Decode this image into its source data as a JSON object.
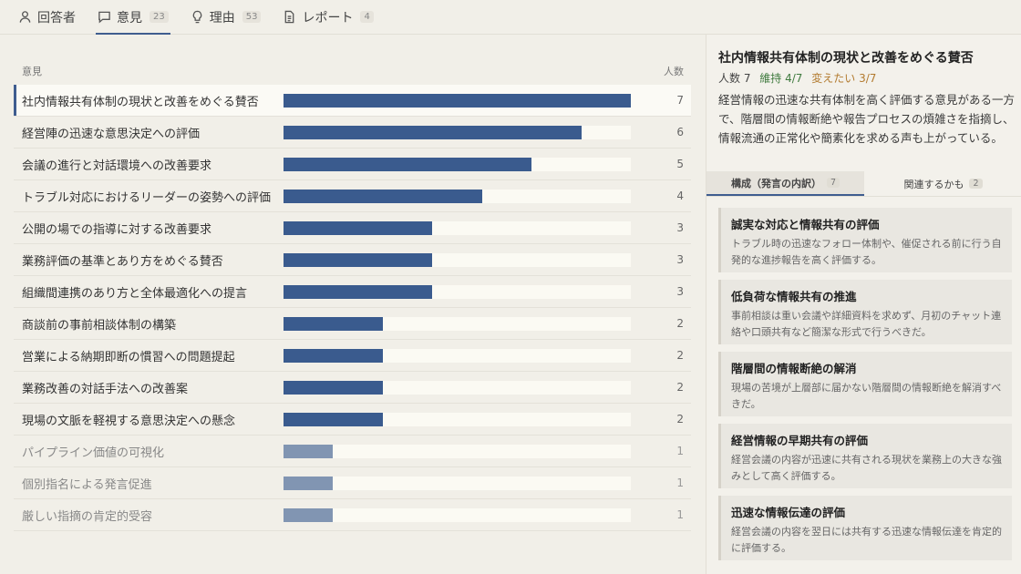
{
  "tabs": [
    {
      "label": "回答者",
      "count": "",
      "icon": "person-icon"
    },
    {
      "label": "意見",
      "count": "23",
      "icon": "comment-icon"
    },
    {
      "label": "理由",
      "count": "53",
      "icon": "lightbulb-icon"
    },
    {
      "label": "レポート",
      "count": "4",
      "icon": "document-icon"
    }
  ],
  "list": {
    "header_label": "意見",
    "header_count": "人数",
    "max": 7,
    "accent_color": "#3a5b8e",
    "rows": [
      {
        "label": "社内情報共有体制の現状と改善をめぐる賛否",
        "count": 7
      },
      {
        "label": "経営陣の迅速な意思決定への評価",
        "count": 6
      },
      {
        "label": "会議の進行と対話環境への改善要求",
        "count": 5
      },
      {
        "label": "トラブル対応におけるリーダーの姿勢への評価",
        "count": 4
      },
      {
        "label": "公開の場での指導に対する改善要求",
        "count": 3
      },
      {
        "label": "業務評価の基準とあり方をめぐる賛否",
        "count": 3
      },
      {
        "label": "組織間連携のあり方と全体最適化への提言",
        "count": 3
      },
      {
        "label": "商談前の事前相談体制の構築",
        "count": 2
      },
      {
        "label": "営業による納期即断の慣習への問題提起",
        "count": 2
      },
      {
        "label": "業務改善の対話手法への改善案",
        "count": 2
      },
      {
        "label": "現場の文脈を軽視する意思決定への懸念",
        "count": 2
      },
      {
        "label": "パイプライン価値の可視化",
        "count": 1
      },
      {
        "label": "個別指名による発言促進",
        "count": 1
      },
      {
        "label": "厳しい指摘の肯定的受容",
        "count": 1
      }
    ]
  },
  "detail": {
    "title": "社内情報共有体制の現状と改善をめぐる賛否",
    "stat_total": "人数 7",
    "stat_keep": "維持 4/7",
    "stat_change": "変えたい 3/7",
    "summary": "経営情報の迅速な共有体制を高く評価する意見がある一方で、階層間の情報断絶や報告プロセスの煩雑さを指摘し、情報流通の正常化や簡素化を求める声も上がっている。",
    "sub_tabs": [
      {
        "label": "構成（発言の内訳）",
        "count": "7"
      },
      {
        "label": "関連するかも",
        "count": "2"
      }
    ],
    "cards": [
      {
        "title": "誠実な対応と情報共有の評価",
        "body": "トラブル時の迅速なフォロー体制や、催促される前に行う自発的な進捗報告を高く評価する。"
      },
      {
        "title": "低負荷な情報共有の推進",
        "body": "事前相談は重い会議や詳細資料を求めず、月初のチャット連絡や口頭共有など簡潔な形式で行うべきだ。"
      },
      {
        "title": "階層間の情報断絶の解消",
        "body": "現場の苦境が上層部に届かない階層間の情報断絶を解消すべきだ。"
      },
      {
        "title": "経営情報の早期共有の評価",
        "body": "経営会議の内容が迅速に共有される現状を業務上の大きな強みとして高く評価する。"
      },
      {
        "title": "迅速な情報伝達の評価",
        "body": "経営会議の内容を翌日には共有する迅速な情報伝達を肯定的に評価する。"
      }
    ]
  }
}
